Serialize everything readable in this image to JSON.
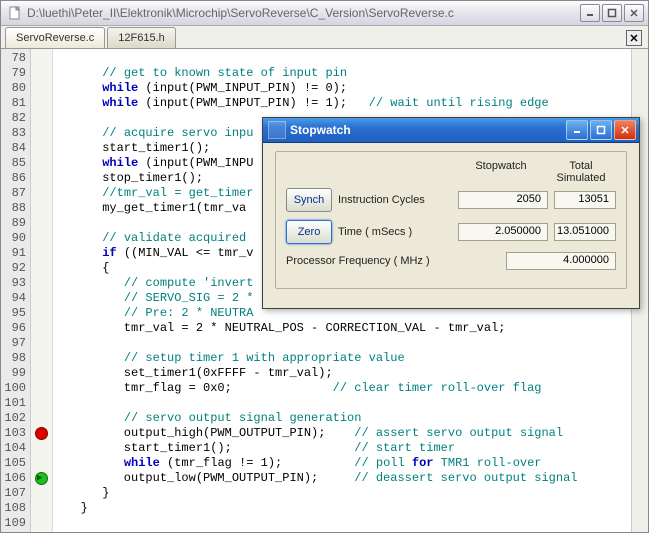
{
  "main_window": {
    "title": "D:\\luethi\\Peter_II\\Elektronik\\Microchip\\ServoReverse\\C_Version\\ServoReverse.c"
  },
  "tabs": [
    {
      "label": "ServoReverse.c",
      "active": true
    },
    {
      "label": "12F615.h",
      "active": false
    }
  ],
  "line_start": 78,
  "line_count": 32,
  "markers": {
    "103": "breakpoint",
    "106": "pc"
  },
  "code_lines": [
    "",
    "      // get to known state of input pin",
    "      while (input(PWM_INPUT_PIN) != 0);",
    "      while (input(PWM_INPUT_PIN) != 1);   // wait until rising edge",
    "",
    "      // acquire servo inpu",
    "      start_timer1();",
    "      while (input(PWM_INPU",
    "      stop_timer1();",
    "      //tmr_val = get_timer",
    "      my_get_timer1(tmr_va",
    "",
    "      // validate acquired ",
    "      if ((MIN_VAL <= tmr_v",
    "      {",
    "         // compute 'invert",
    "         // SERVO_SIG = 2 *",
    "         // Pre: 2 * NEUTRA",
    "         tmr_val = 2 * NEUTRAL_POS - CORRECTION_VAL - tmr_val;",
    "",
    "         // setup timer 1 with appropriate value",
    "         set_timer1(0xFFFF - tmr_val);",
    "         tmr_flag = 0x0;              // clear timer roll-over flag",
    "",
    "         // servo output signal generation",
    "         output_high(PWM_OUTPUT_PIN);    // assert servo output signal",
    "         start_timer1();                 // start timer",
    "         while (tmr_flag != 1);          // poll for TMR1 roll-over",
    "         output_low(PWM_OUTPUT_PIN);     // deassert servo output signal",
    "      }",
    "   }",
    ""
  ],
  "stopwatch": {
    "title": "Stopwatch",
    "col1": "Stopwatch",
    "col2": "Total Simulated",
    "synch_label": "Synch",
    "zero_label": "Zero",
    "row_cycles_label": "Instruction  Cycles",
    "row_cycles_v1": "2050",
    "row_cycles_v2": "13051",
    "row_time_label": "Time   ( mSecs )",
    "row_time_v1": "2.050000",
    "row_time_v2": "13.051000",
    "row_freq_label": "Processor Frequency    ( MHz )",
    "row_freq_v": "4.000000"
  }
}
